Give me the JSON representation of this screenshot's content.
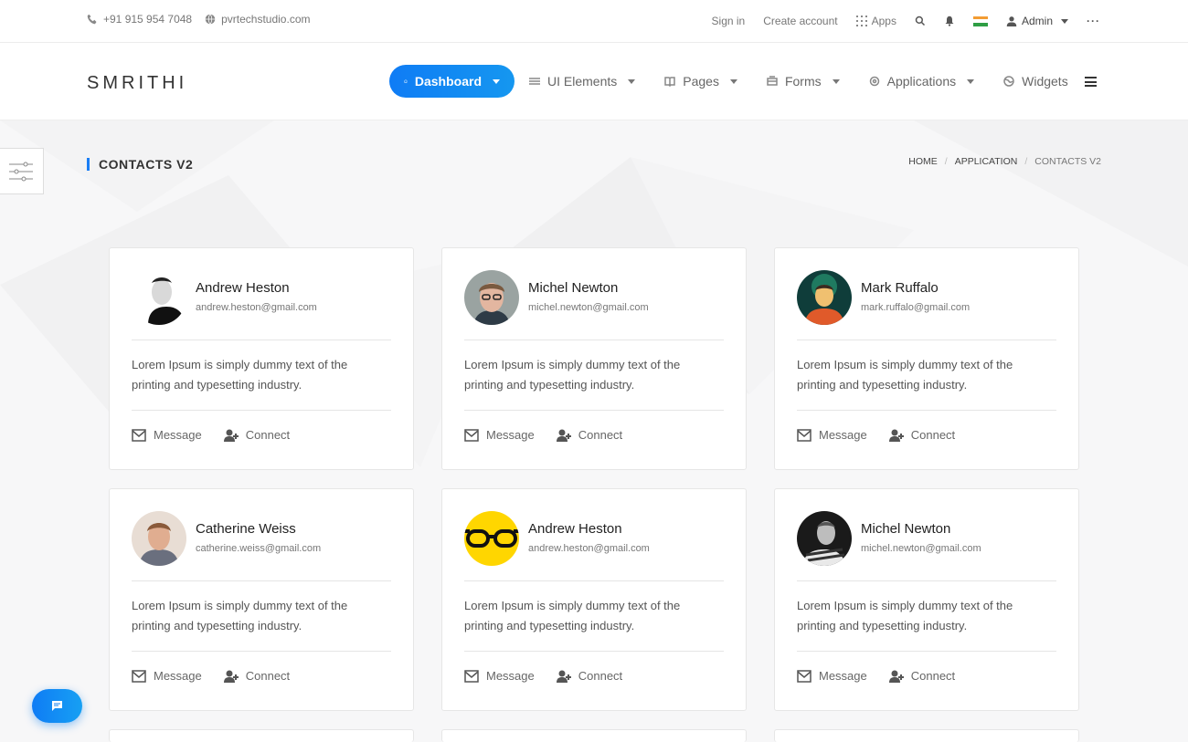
{
  "topbar": {
    "phone": "+91 915 954 7048",
    "website": "pvrtechstudio.com",
    "sign_in": "Sign in",
    "create_account": "Create account",
    "apps": "Apps",
    "user": "Admin"
  },
  "nav": {
    "brand": "SMRITHI",
    "items": [
      {
        "label": "Dashboard",
        "icon": "home-icon"
      },
      {
        "label": "UI Elements",
        "icon": "sliders-icon"
      },
      {
        "label": "Pages",
        "icon": "book-icon"
      },
      {
        "label": "Forms",
        "icon": "inbox-icon"
      },
      {
        "label": "Applications",
        "icon": "settings-icon"
      },
      {
        "label": "Widgets",
        "icon": "globe-icon"
      }
    ]
  },
  "page": {
    "title": "CONTACTS V2",
    "breadcrumb": [
      "HOME",
      "APPLICATION",
      "CONTACTS V2"
    ]
  },
  "contacts": [
    {
      "name": "Andrew Heston",
      "email": "andrew.heston@gmail.com",
      "desc": "Lorem Ipsum is simply dummy text of the printing and typesetting industry.",
      "message": "Message",
      "connect": "Connect"
    },
    {
      "name": "Michel Newton",
      "email": "michel.newton@gmail.com",
      "desc": "Lorem Ipsum is simply dummy text of the printing and typesetting industry.",
      "message": "Message",
      "connect": "Connect"
    },
    {
      "name": "Mark Ruffalo",
      "email": "mark.ruffalo@gmail.com",
      "desc": "Lorem Ipsum is simply dummy text of the printing and typesetting industry.",
      "message": "Message",
      "connect": "Connect"
    },
    {
      "name": "Catherine Weiss",
      "email": "catherine.weiss@gmail.com",
      "desc": "Lorem Ipsum is simply dummy text of the printing and typesetting industry.",
      "message": "Message",
      "connect": "Connect"
    },
    {
      "name": "Andrew Heston",
      "email": "andrew.heston@gmail.com",
      "desc": "Lorem Ipsum is simply dummy text of the printing and typesetting industry.",
      "message": "Message",
      "connect": "Connect"
    },
    {
      "name": "Michel Newton",
      "email": "michel.newton@gmail.com",
      "desc": "Lorem Ipsum is simply dummy text of the printing and typesetting industry.",
      "message": "Message",
      "connect": "Connect"
    }
  ],
  "colors": {
    "accent": "#0f7cf5",
    "page_bg": "#f7f7f8",
    "card_bg": "#ffffff"
  }
}
